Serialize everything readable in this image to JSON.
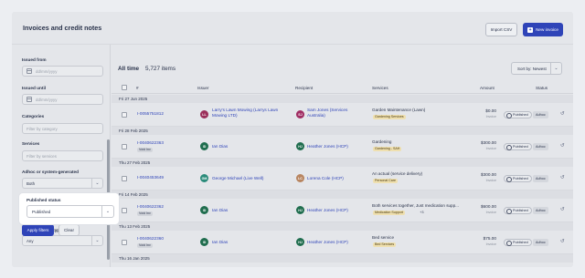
{
  "header": {
    "title": "Invoices and credit notes",
    "import_label": "Import CSV",
    "new_label": "New invoice"
  },
  "filters": {
    "issued_from_label": "Issued from",
    "issued_from_placeholder": "dd/mm/yyyy",
    "issued_until_label": "Issued until",
    "issued_until_placeholder": "dd/mm/yyyy",
    "categories_label": "Categories",
    "categories_placeholder": "Filter by category",
    "services_label": "Services",
    "services_placeholder": "Filter by services",
    "adhoc_label": "Adhoc or system-generated",
    "adhoc_value": "Both",
    "published_label": "Published status",
    "published_value": "Published",
    "source_label": "Invoice source type",
    "source_value": "Any",
    "apply_label": "Apply filters",
    "clear_label": "Clear"
  },
  "list": {
    "all_label": "All time",
    "count_text": "5,727 items",
    "sort_label": "Sort by: Newest",
    "columns": {
      "number": "#",
      "issuer": "Issuer",
      "recipient": "Recipient",
      "services": "Services",
      "amount": "Amount",
      "status": "Status"
    },
    "groups": [
      {
        "date": "Fri 27 Jun 2025",
        "rows": [
          {
            "id": "I-0055751812",
            "tag": "",
            "issuer_initials": "LL",
            "issuer_color": "#9b2f5a",
            "issuer": [
              "Larry's Lawn Mowing (Larrys Lawn",
              "Mowing LTD)"
            ],
            "recipient_initials": "SJ",
            "recipient_color": "#a02d63",
            "recipient": [
              "Sam Jones (Services",
              "Australia)"
            ],
            "service": "Garden Maintenance (Lawn)",
            "service_chips": [
              "Gardening Services"
            ],
            "amount": "$0.00",
            "amount_sub": "Invoice",
            "status": "Published",
            "adhoc": "Adhoc"
          }
        ]
      },
      {
        "date": "Fri 28 Feb 2025",
        "rows": [
          {
            "id": "I-0040622363",
            "tag": "Void Inv",
            "issuer_initials": "ID",
            "issuer_color": "#1f6d4e",
            "issuer": [
              "Ian Dias"
            ],
            "recipient_initials": "HJ",
            "recipient_color": "#1f6d4e",
            "recipient": [
              "Heather Jones (HCP)"
            ],
            "service": "Gardening",
            "service_chips": [
              "Gardening - SAH"
            ],
            "amount": "$300.00",
            "amount_sub": "Invoice",
            "status": "Published",
            "adhoc": "Adhoc"
          }
        ]
      },
      {
        "date": "Thu 27 Feb 2025",
        "rows": [
          {
            "id": "I-0040453649",
            "tag": "",
            "issuer_initials": "GM",
            "issuer_color": "#2a8b7a",
            "issuer": [
              "George Michael (Live Well)"
            ],
            "recipient_initials": "LC",
            "recipient_color": "#b88560",
            "recipient": [
              "Lorena Cole (HCP)"
            ],
            "service": "An actual (service delivery)",
            "service_chips": [
              "Personal Care"
            ],
            "amount": "$300.00",
            "amount_sub": "Invoice",
            "status": "Published",
            "adhoc": "Adhoc"
          }
        ]
      },
      {
        "date": "Fri 14 Feb 2025",
        "rows": [
          {
            "id": "I-0040622362",
            "tag": "Void Inv",
            "issuer_initials": "ID",
            "issuer_color": "#1f6d4e",
            "issuer": [
              "Ian Dias"
            ],
            "recipient_initials": "HJ",
            "recipient_color": "#1f6d4e",
            "recipient": [
              "Heather Jones (HCP)"
            ],
            "service": "Both services together, Just medication supp...",
            "service_chips": [
              "Medication Support",
              "+3"
            ],
            "amount": "$600.00",
            "amount_sub": "Invoice",
            "status": "Published",
            "adhoc": "Adhoc"
          }
        ]
      },
      {
        "date": "Thu 13 Feb 2025",
        "rows": [
          {
            "id": "I-0040622360",
            "tag": "Void Inv",
            "issuer_initials": "ID",
            "issuer_color": "#1f6d4e",
            "issuer": [
              "Ian Dias"
            ],
            "recipient_initials": "HJ",
            "recipient_color": "#1f6d4e",
            "recipient": [
              "Heather Jones (HCP)"
            ],
            "service": "Bed service",
            "service_chips": [
              "Bed Services"
            ],
            "amount": "$75.00",
            "amount_sub": "Invoice",
            "status": "Published",
            "adhoc": "Adhoc"
          }
        ]
      },
      {
        "date": "Thu 16 Jan 2025",
        "rows": []
      }
    ]
  }
}
